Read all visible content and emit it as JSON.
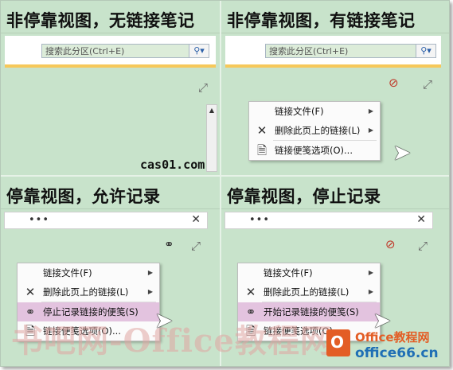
{
  "quadrants": {
    "q1": {
      "title": "非停靠视图，无链接笔记",
      "search_placeholder": "搜索此分区(Ctrl+E)",
      "caption": "cas01.com"
    },
    "q2": {
      "title": "非停靠视图，有链接笔记",
      "search_placeholder": "搜索此分区(Ctrl+E)"
    },
    "q3": {
      "title": "停靠视图，允许记录",
      "note_dots": "•••"
    },
    "q4": {
      "title": "停靠视图，停止记录",
      "note_dots": "•••"
    }
  },
  "menus": {
    "q2": [
      {
        "label": "链接文件(F)",
        "icon": "none",
        "submenu": true
      },
      {
        "label": "删除此页上的链接(L)",
        "icon": "x-icon",
        "submenu": true
      },
      {
        "label": "链接便笺选项(O)...",
        "icon": "options-icon",
        "submenu": false
      }
    ],
    "q3": [
      {
        "label": "链接文件(F)",
        "icon": "none",
        "submenu": true
      },
      {
        "label": "删除此页上的链接(L)",
        "icon": "x-icon",
        "submenu": true
      },
      {
        "label": "停止记录链接的便笺(S)",
        "icon": "stop-link-icon",
        "submenu": false,
        "highlighted": true
      },
      {
        "label": "链接便笺选项(O)...",
        "icon": "options-icon",
        "submenu": false
      }
    ],
    "q4": [
      {
        "label": "链接文件(F)",
        "icon": "none",
        "submenu": true
      },
      {
        "label": "删除此页上的链接(L)",
        "icon": "x-icon",
        "submenu": true
      },
      {
        "label": "开始记录链接的便笺(S)",
        "icon": "start-link-icon",
        "submenu": false,
        "highlighted": true
      },
      {
        "label": "链接便笺选项(O)...",
        "icon": "options-icon",
        "submenu": false
      }
    ]
  },
  "watermark": "书吧网-Office教程网",
  "logo": {
    "top": "Office教程网",
    "bottom": "office66.cn"
  },
  "colors": {
    "background": "#c8e3cb",
    "highlight": "#e3c3df",
    "accent_yellow": "#f6c85a",
    "logo_orange": "#e35d25",
    "logo_blue": "#1f6fb5"
  }
}
